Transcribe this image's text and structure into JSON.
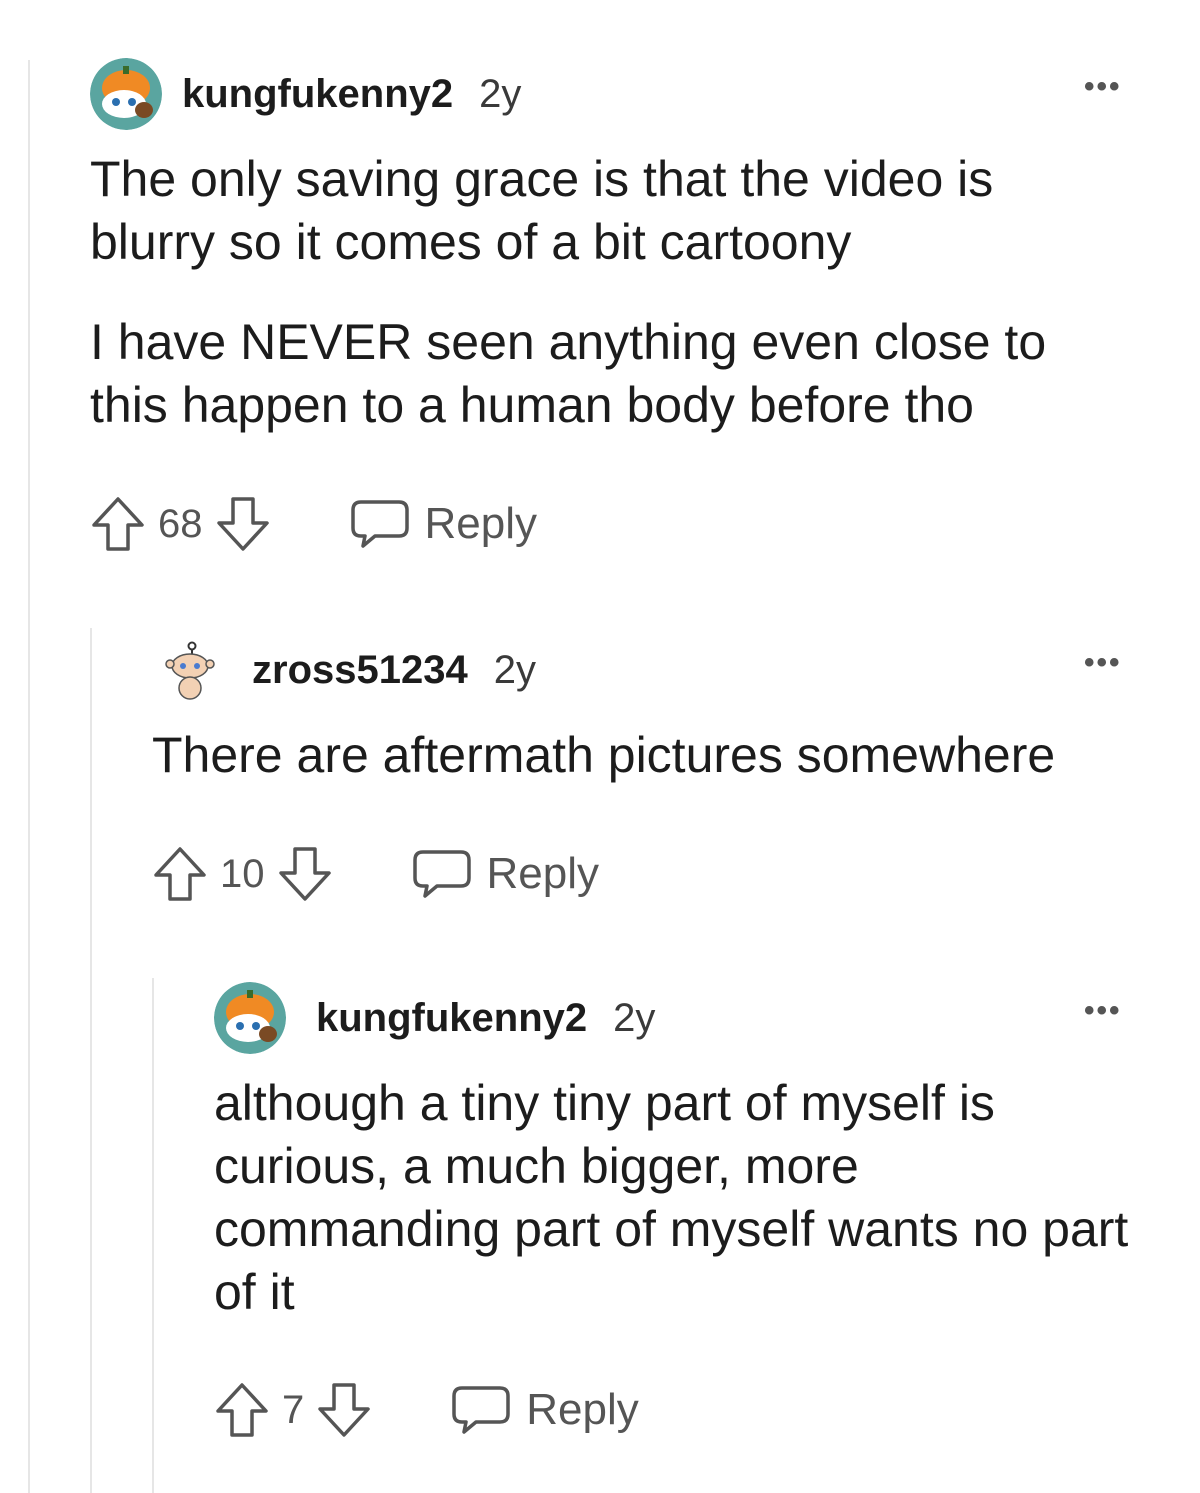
{
  "colors": {
    "text": "#1c1c1c",
    "muted": "#555555",
    "thread_line": "#e6e6e6"
  },
  "comments": [
    {
      "username": "kungfukenny2",
      "age": "2y",
      "avatar_icon": "snoo-pumpkin-avatar",
      "paragraphs": [
        "The only saving grace is that the video is blurry so it comes of a bit cartoony",
        "I have NEVER seen anything even close to this happen to a human body before tho"
      ],
      "votes": "68",
      "reply_label": "Reply",
      "more_label": "•••"
    },
    {
      "username": "zross51234",
      "age": "2y",
      "avatar_icon": "snoo-default-avatar",
      "paragraphs": [
        "There are aftermath pictures somewhere"
      ],
      "votes": "10",
      "reply_label": "Reply",
      "more_label": "•••"
    },
    {
      "username": "kungfukenny2",
      "age": "2y",
      "avatar_icon": "snoo-pumpkin-avatar",
      "paragraphs": [
        "although a tiny tiny part of myself is curious, a much bigger, more commanding part of myself wants no part of it"
      ],
      "votes": "7",
      "reply_label": "Reply",
      "more_label": "•••"
    }
  ]
}
